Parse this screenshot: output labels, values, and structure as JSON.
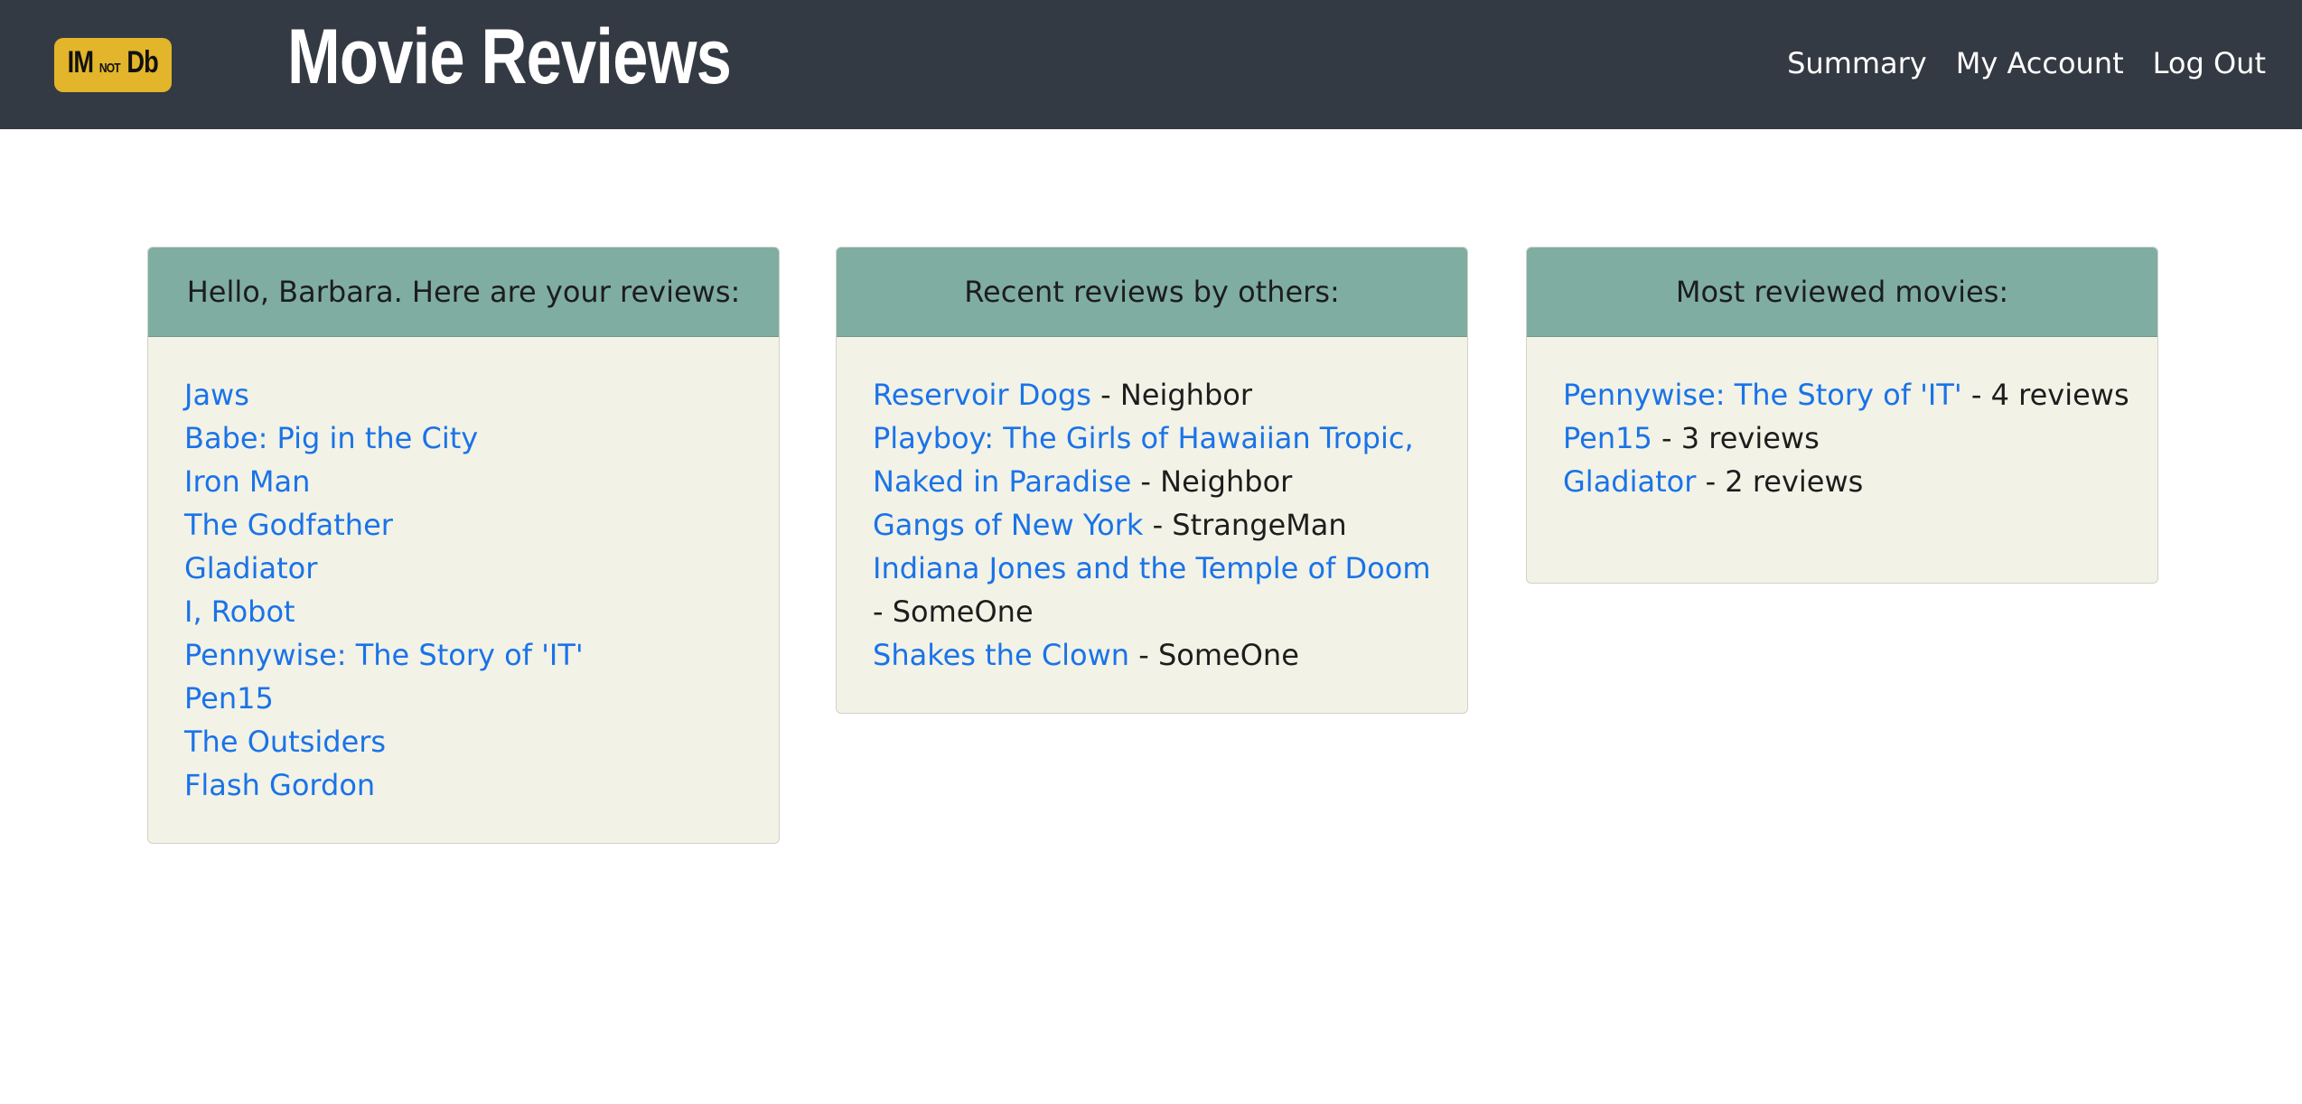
{
  "header": {
    "logo_text_1": "IM",
    "logo_text_2": "NOT",
    "logo_text_3": "Db",
    "title": "Movie Reviews",
    "nav": [
      "Summary",
      "My Account",
      "Log Out"
    ]
  },
  "my_reviews": {
    "heading": "Hello, Barbara. Here are your reviews:",
    "items": [
      "Jaws",
      "Babe: Pig in the City",
      "Iron Man",
      "The Godfather",
      "Gladiator",
      "I, Robot",
      "Pennywise: The Story of 'IT'",
      "Pen15",
      "The Outsiders",
      "Flash Gordon"
    ]
  },
  "recent_reviews": {
    "heading": "Recent reviews by others:",
    "items": [
      {
        "movie": "Reservoir Dogs",
        "suffix": " - Neighbor"
      },
      {
        "movie": "Playboy: The Girls of Hawaiian Tropic, Naked in Paradise",
        "suffix": " - Neighbor"
      },
      {
        "movie": "Gangs of New York",
        "suffix": " - StrangeMan"
      },
      {
        "movie": "Indiana Jones and the Temple of Doom",
        "suffix": " - SomeOne"
      },
      {
        "movie": "Shakes the Clown",
        "suffix": " - SomeOne"
      }
    ]
  },
  "most_reviewed": {
    "heading": "Most reviewed movies:",
    "items": [
      {
        "movie": "Pennywise: The Story of 'IT'",
        "suffix": " - 4 reviews"
      },
      {
        "movie": "Pen15",
        "suffix": " - 3 reviews"
      },
      {
        "movie": "Gladiator",
        "suffix": " - 2 reviews"
      }
    ]
  },
  "colors": {
    "navbar": "#343a43",
    "logo": "#e2b52b",
    "card_header": "#7fada2",
    "card_body": "#f2f2e6",
    "link": "#1a73e8"
  }
}
